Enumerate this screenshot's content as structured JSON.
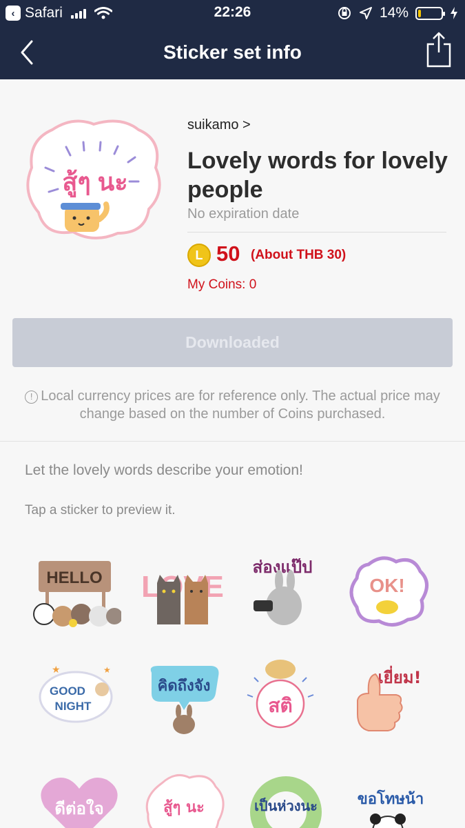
{
  "status": {
    "carrier": "Safari",
    "time": "22:26",
    "battery": "14%",
    "battery_level": 0.14
  },
  "nav": {
    "title": "Sticker set info"
  },
  "header": {
    "author": "suikamo >",
    "title": "Lovely words for lovely people",
    "expiry": "No expiration date",
    "coin_symbol": "L",
    "price": "50",
    "price_local": "(About THB 30)",
    "my_coins": "My Coins: 0"
  },
  "download_button": "Downloaded",
  "notice": "Local currency prices are for reference only. The actual price may change based on the number of Coins purchased.",
  "description": "Let the lovely words describe your emotion!",
  "hint": "Tap a sticker to preview it.",
  "stickers": {
    "hello": "HELLO",
    "love": "LOVE",
    "thai1": "ส่องแป๊ป",
    "ok": "OK!",
    "good": "GOOD",
    "night": "NIGHT",
    "thai2": "คิดถึงจัง",
    "thai3": "สติ",
    "thai4": "เยี่ยม!",
    "thai5": "ดีต่อใจ",
    "thai6": "สู้ๆ นะ",
    "thai7": "เป็นห่วงนะ",
    "thai8": "ขอโทษน้า"
  },
  "colors": {
    "nav_bg": "#1f2a44",
    "price_red": "#d0121b",
    "coin_gold": "#f0c419",
    "button_disabled": "#c8ccd6"
  }
}
